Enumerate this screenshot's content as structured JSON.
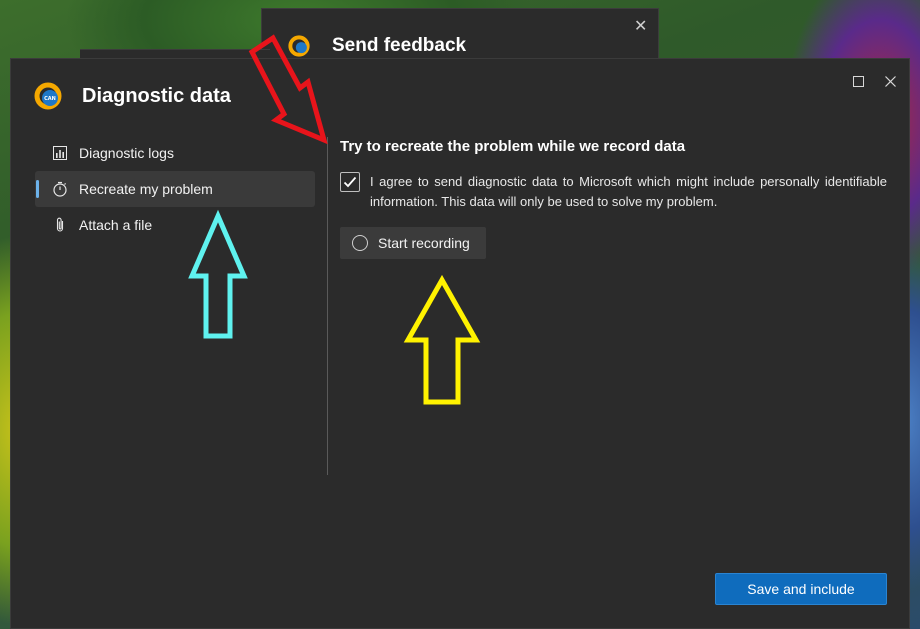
{
  "background_window": {
    "title": "Send feedback"
  },
  "dialog": {
    "title": "Diagnostic data",
    "maximize_icon": "maximize-icon",
    "close_icon": "close-icon"
  },
  "sidebar": {
    "items": [
      {
        "label": "Diagnostic logs",
        "icon": "bar-chart-icon",
        "selected": false
      },
      {
        "label": "Recreate my problem",
        "icon": "stopwatch-icon",
        "selected": true
      },
      {
        "label": "Attach a file",
        "icon": "paperclip-icon",
        "selected": false
      }
    ]
  },
  "content": {
    "title": "Try to recreate the problem while we record data",
    "consent": {
      "checked": true,
      "text": "I agree to send diagnostic data to Microsoft which might include personally identifiable information. This data will only be used to solve my problem."
    },
    "record_button": "Start recording"
  },
  "footer": {
    "primary_button": "Save and include"
  },
  "colors": {
    "dialog_bg": "#2b2b2b",
    "accent": "#0f6cbd",
    "selection_indicator": "#6cb2ea",
    "annotation_red": "#e8141b",
    "annotation_cyan": "#5ff2ef",
    "annotation_yellow": "#fff200"
  }
}
